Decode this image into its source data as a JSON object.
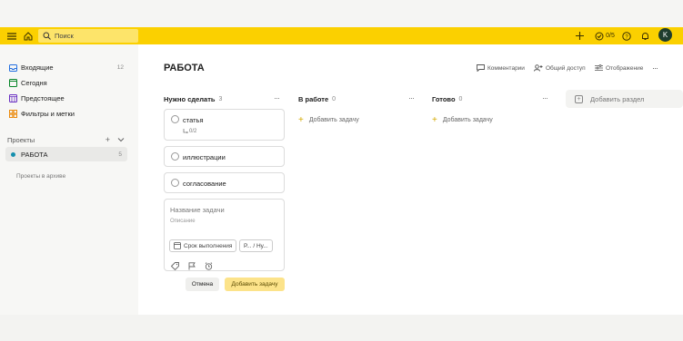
{
  "topbar": {
    "search_placeholder": "Поиск",
    "karma": "0/5",
    "avatar_letter": "K"
  },
  "sidebar": {
    "items": [
      {
        "label": "Входящие",
        "count": "12"
      },
      {
        "label": "Сегодня",
        "count": ""
      },
      {
        "label": "Предстоящее",
        "count": ""
      },
      {
        "label": "Фильтры и метки",
        "count": ""
      }
    ],
    "projects_label": "Проекты",
    "projects": [
      {
        "label": "РАБОТА",
        "count": "5"
      }
    ],
    "archive_label": "Проекты в архиве"
  },
  "main": {
    "title": "РАБОТА",
    "actions": {
      "comments": "Комментарии",
      "share": "Общий доступ",
      "view": "Отображение"
    },
    "columns": [
      {
        "title": "Нужно сделать",
        "count": "3"
      },
      {
        "title": "В работе",
        "count": "0",
        "add_label": "Добавить задачу"
      },
      {
        "title": "Готово",
        "count": "0",
        "add_label": "Добавить задачу"
      }
    ],
    "tasks": [
      {
        "title": "статья",
        "subtasks": "0/2"
      },
      {
        "title": "иллюстрации"
      },
      {
        "title": "согласование"
      }
    ],
    "add_section": "Добавить раздел",
    "editor": {
      "name_placeholder": "Название задачи",
      "desc_placeholder": "Описание",
      "due_label": "Срок выполнения",
      "project_label": "Р... / Ну..."
    },
    "buttons": {
      "cancel": "Отмена",
      "add_task": "Добавить задачу"
    }
  },
  "colors": {
    "topbar": "#fbd000",
    "accent_button": "#fce38a",
    "project_dot": "#158fad",
    "avatar": "#1f3d2e"
  }
}
